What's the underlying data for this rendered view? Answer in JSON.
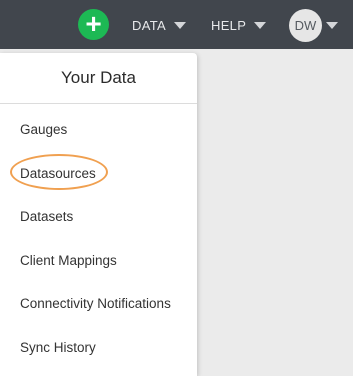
{
  "topbar": {
    "add_icon": "plus-icon",
    "add_glyph": "+",
    "nav": [
      {
        "label": "DATA"
      },
      {
        "label": "HELP"
      }
    ],
    "avatar_initials": "DW"
  },
  "dropdown": {
    "title": "Your Data",
    "items": [
      {
        "label": "Gauges"
      },
      {
        "label": "Datasources",
        "highlighted": true
      },
      {
        "label": "Datasets"
      },
      {
        "label": "Client Mappings"
      },
      {
        "label": "Connectivity Notifications"
      },
      {
        "label": "Sync History"
      }
    ]
  },
  "colors": {
    "topbar": "#41464d",
    "add_button": "#1db954",
    "highlight_ring": "#f0a050"
  }
}
